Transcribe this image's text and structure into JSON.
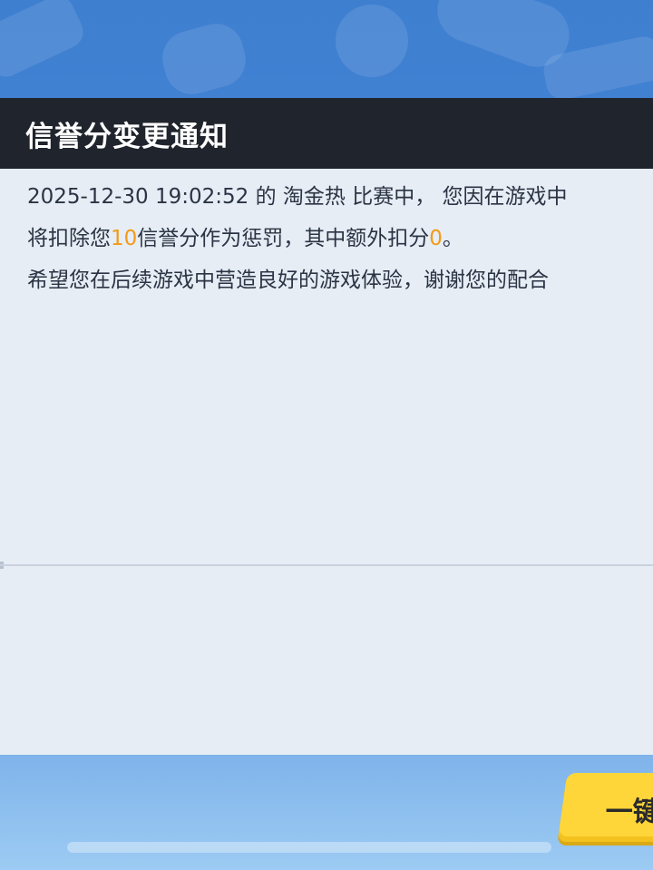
{
  "dialog": {
    "title": "信誉分变更通知",
    "line1": "2025-12-30 19:02:52 的 淘金热 比赛中， 您因在游戏中",
    "line2_prefix": "将扣除您",
    "penalty_points": "10",
    "line2_middle": "信誉分作为惩罚，其中额外扣分",
    "extra_points": "0",
    "line2_suffix": "。",
    "line3": "希望您在后续游戏中营造良好的游戏体验，谢谢您的配合",
    "highlight_color": "#f39a16"
  },
  "footer": {
    "confirm_label": "一键"
  }
}
